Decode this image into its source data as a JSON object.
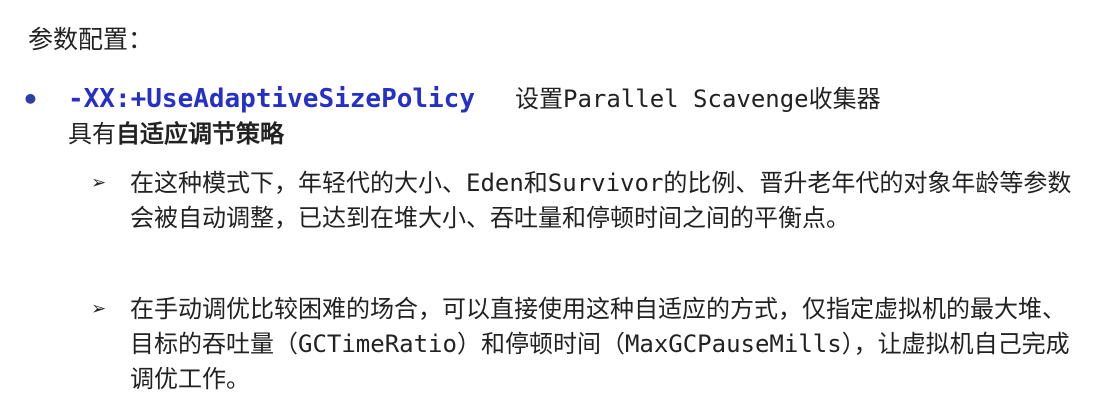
{
  "heading": "参数配置：",
  "bullet": {
    "marker": "•",
    "option": "-XX:+UseAdaptiveSizePolicy",
    "description": "设置Parallel Scavenge收集器",
    "continuation_prefix": "具有",
    "continuation_bold": "自适应调节策略"
  },
  "sub_items": [
    {
      "marker": "➢",
      "text": "在这种模式下，年轻代的大小、Eden和Survivor的比例、晋升老年代的对象年龄等参数会被自动调整，已达到在堆大小、吞吐量和停顿时间之间的平衡点。"
    },
    {
      "marker": "➢",
      "text": "在手动调优比较困难的场合，可以直接使用这种自适应的方式，仅指定虚拟机的最大堆、目标的吞吐量（GCTimeRatio）和停顿时间（MaxGCPauseMills），让虚拟机自己完成调优工作。"
    }
  ],
  "colors": {
    "option_text": "#2530c8",
    "bullet_dot": "#2c3ea8",
    "body_text": "#222222"
  }
}
